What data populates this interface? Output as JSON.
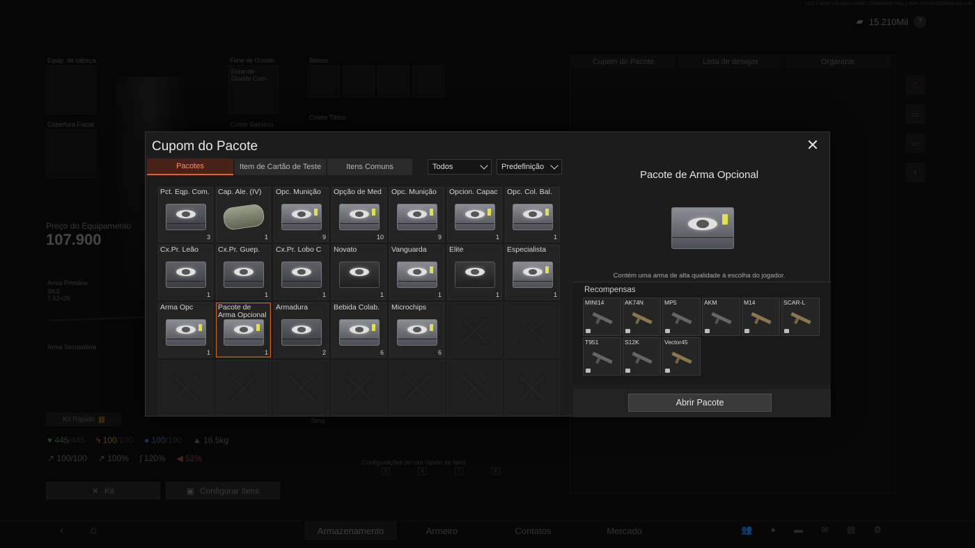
{
  "top": {
    "currency": "15.210Mil",
    "help": "?",
    "version": "1.0.0.1 NEXE UNI.1021A.GRODI 17548482929 INE2.1-8096 4100001103333@1500.0.60"
  },
  "background": {
    "labels": {
      "head": "Equip. de cabeça",
      "headset": "Fone de Ouvido",
      "headset_item": "Fone de Ouvido Com.",
      "pockets": "Bolsos",
      "face": "Cobertura Facial",
      "vest": "Colete Balístico",
      "vest2": "Colete Tático",
      "primary": "Arma Primária",
      "primary_item": "SKS",
      "primary_ammo": "7.62×39",
      "secondary": "Arma Secundária",
      "sling": "Sling",
      "quick_cfg": "Configurações de uso rápido de itens"
    },
    "price_label": "Preço do Equipamento",
    "price_value": "107.900",
    "quick_kit": "Kit Rápido",
    "quick_kit_badge": "!",
    "stats_row1": {
      "hp": "445",
      "hp_max": "/445",
      "energy": "100",
      "energy_max": "/100",
      "water": "100",
      "water_max": "/100",
      "weight": "16.5kg"
    },
    "stats_row2": {
      "a": "100/100",
      "b": "100%",
      "c": "120%",
      "d": "52%"
    },
    "kit_button": "Kit",
    "config_button": "Configurar Itens",
    "quick_keys": [
      "5",
      "6",
      "7",
      "8"
    ],
    "right_tabs": [
      "Cupom do Pacote",
      "Lista de desejos",
      "Organizar"
    ],
    "nav": [
      "Armazenamento",
      "Armeiro",
      "Contatos",
      "Mercado"
    ]
  },
  "modal": {
    "title": "Cupom do Pacote",
    "tabs": [
      "Pacotes",
      "Item de Cartão de Teste",
      "Itens Comuns"
    ],
    "filter_value": "Todos",
    "preset_value": "Predefinição",
    "items": [
      {
        "name": "Pct. Eqp. Com.",
        "count": "3",
        "art": "box"
      },
      {
        "name": "Cap. Ale. (IV)",
        "count": "1",
        "art": "bag"
      },
      {
        "name": "Opc. Munição",
        "count": "9",
        "art": "steel"
      },
      {
        "name": "Opção de Med",
        "count": "10",
        "art": "steel"
      },
      {
        "name": "Opc. Munição",
        "count": "9",
        "art": "steel"
      },
      {
        "name": "Opcion. Capac",
        "count": "1",
        "art": "steel"
      },
      {
        "name": "Opc. Col. Bal.",
        "count": "1",
        "art": "steel"
      },
      {
        "name": "Cx.Pr. Leão",
        "count": "1",
        "art": "box"
      },
      {
        "name": "Cx.Pr. Guep.",
        "count": "1",
        "art": "box"
      },
      {
        "name": "Cx.Pr. Lobo C",
        "count": "1",
        "art": "box"
      },
      {
        "name": "Novato",
        "count": "1",
        "art": "dark"
      },
      {
        "name": "Vanguarda",
        "count": "1",
        "art": "steel"
      },
      {
        "name": "Elite",
        "count": "1",
        "art": "dark"
      },
      {
        "name": "Especialista",
        "count": "1",
        "art": "steel"
      },
      {
        "name": "Arma Opc",
        "count": "1",
        "art": "steel"
      },
      {
        "name": "Pacote de Arma Opcional",
        "count": "1",
        "art": "steel",
        "selected": true
      },
      {
        "name": "Armadura",
        "count": "2",
        "art": "box"
      },
      {
        "name": "Bebida Colab.",
        "count": "6",
        "art": "steel"
      },
      {
        "name": "Microchips",
        "count": "6",
        "art": "steel"
      }
    ],
    "detail": {
      "title": "Pacote de Arma Opcional",
      "description": "Contém uma arma de alta qualidade à escolha do jogador.",
      "rewards_label": "Recompensas",
      "rewards": [
        {
          "name": "MINI14",
          "tone": "gray"
        },
        {
          "name": "AK74N",
          "tone": "tan"
        },
        {
          "name": "MP5",
          "tone": "gray"
        },
        {
          "name": "AKM",
          "tone": "gray"
        },
        {
          "name": "M14",
          "tone": "tan"
        },
        {
          "name": "SCAR-L",
          "tone": "tan"
        },
        {
          "name": "T951",
          "tone": "gray"
        },
        {
          "name": "S12K",
          "tone": "gray"
        },
        {
          "name": "Vector45",
          "tone": "tan"
        }
      ],
      "open_button": "Abrir Pacote"
    }
  }
}
